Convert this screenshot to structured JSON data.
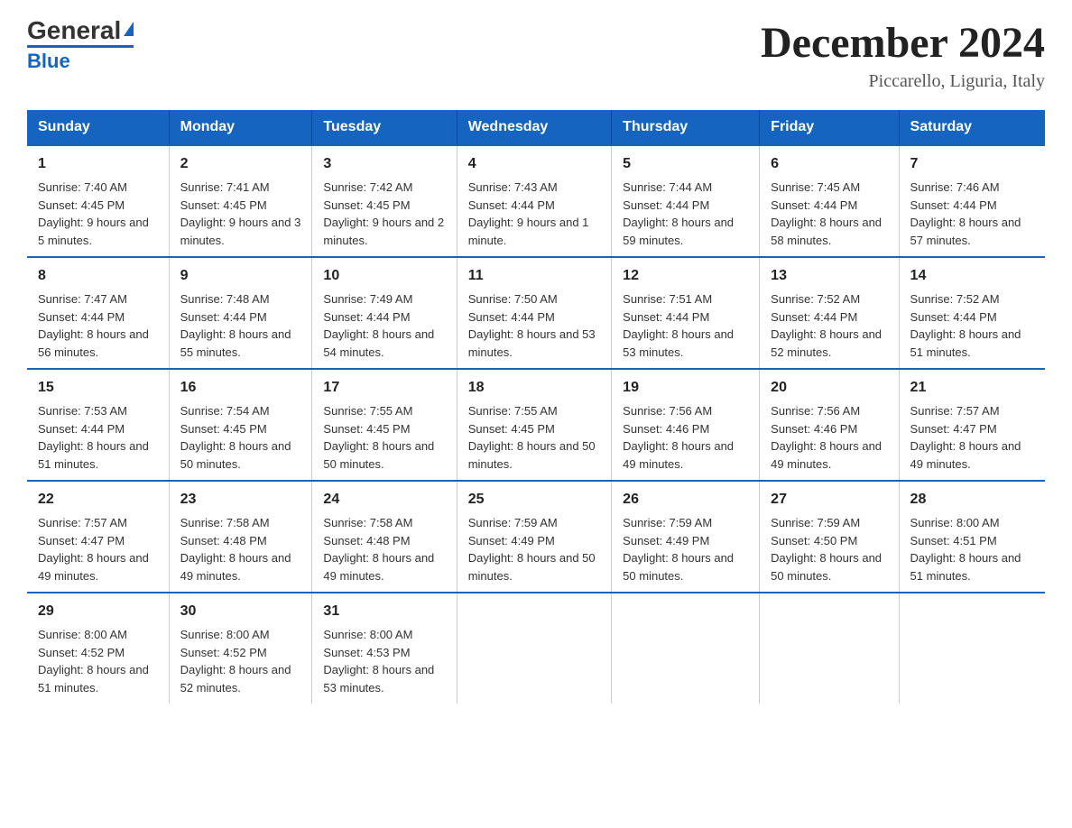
{
  "header": {
    "logo_general": "General",
    "logo_blue": "Blue",
    "month_title": "December 2024",
    "location": "Piccarello, Liguria, Italy"
  },
  "days_of_week": [
    "Sunday",
    "Monday",
    "Tuesday",
    "Wednesday",
    "Thursday",
    "Friday",
    "Saturday"
  ],
  "weeks": [
    [
      {
        "day": "1",
        "sunrise": "7:40 AM",
        "sunset": "4:45 PM",
        "daylight": "9 hours and 5 minutes."
      },
      {
        "day": "2",
        "sunrise": "7:41 AM",
        "sunset": "4:45 PM",
        "daylight": "9 hours and 3 minutes."
      },
      {
        "day": "3",
        "sunrise": "7:42 AM",
        "sunset": "4:45 PM",
        "daylight": "9 hours and 2 minutes."
      },
      {
        "day": "4",
        "sunrise": "7:43 AM",
        "sunset": "4:44 PM",
        "daylight": "9 hours and 1 minute."
      },
      {
        "day": "5",
        "sunrise": "7:44 AM",
        "sunset": "4:44 PM",
        "daylight": "8 hours and 59 minutes."
      },
      {
        "day": "6",
        "sunrise": "7:45 AM",
        "sunset": "4:44 PM",
        "daylight": "8 hours and 58 minutes."
      },
      {
        "day": "7",
        "sunrise": "7:46 AM",
        "sunset": "4:44 PM",
        "daylight": "8 hours and 57 minutes."
      }
    ],
    [
      {
        "day": "8",
        "sunrise": "7:47 AM",
        "sunset": "4:44 PM",
        "daylight": "8 hours and 56 minutes."
      },
      {
        "day": "9",
        "sunrise": "7:48 AM",
        "sunset": "4:44 PM",
        "daylight": "8 hours and 55 minutes."
      },
      {
        "day": "10",
        "sunrise": "7:49 AM",
        "sunset": "4:44 PM",
        "daylight": "8 hours and 54 minutes."
      },
      {
        "day": "11",
        "sunrise": "7:50 AM",
        "sunset": "4:44 PM",
        "daylight": "8 hours and 53 minutes."
      },
      {
        "day": "12",
        "sunrise": "7:51 AM",
        "sunset": "4:44 PM",
        "daylight": "8 hours and 53 minutes."
      },
      {
        "day": "13",
        "sunrise": "7:52 AM",
        "sunset": "4:44 PM",
        "daylight": "8 hours and 52 minutes."
      },
      {
        "day": "14",
        "sunrise": "7:52 AM",
        "sunset": "4:44 PM",
        "daylight": "8 hours and 51 minutes."
      }
    ],
    [
      {
        "day": "15",
        "sunrise": "7:53 AM",
        "sunset": "4:44 PM",
        "daylight": "8 hours and 51 minutes."
      },
      {
        "day": "16",
        "sunrise": "7:54 AM",
        "sunset": "4:45 PM",
        "daylight": "8 hours and 50 minutes."
      },
      {
        "day": "17",
        "sunrise": "7:55 AM",
        "sunset": "4:45 PM",
        "daylight": "8 hours and 50 minutes."
      },
      {
        "day": "18",
        "sunrise": "7:55 AM",
        "sunset": "4:45 PM",
        "daylight": "8 hours and 50 minutes."
      },
      {
        "day": "19",
        "sunrise": "7:56 AM",
        "sunset": "4:46 PM",
        "daylight": "8 hours and 49 minutes."
      },
      {
        "day": "20",
        "sunrise": "7:56 AM",
        "sunset": "4:46 PM",
        "daylight": "8 hours and 49 minutes."
      },
      {
        "day": "21",
        "sunrise": "7:57 AM",
        "sunset": "4:47 PM",
        "daylight": "8 hours and 49 minutes."
      }
    ],
    [
      {
        "day": "22",
        "sunrise": "7:57 AM",
        "sunset": "4:47 PM",
        "daylight": "8 hours and 49 minutes."
      },
      {
        "day": "23",
        "sunrise": "7:58 AM",
        "sunset": "4:48 PM",
        "daylight": "8 hours and 49 minutes."
      },
      {
        "day": "24",
        "sunrise": "7:58 AM",
        "sunset": "4:48 PM",
        "daylight": "8 hours and 49 minutes."
      },
      {
        "day": "25",
        "sunrise": "7:59 AM",
        "sunset": "4:49 PM",
        "daylight": "8 hours and 50 minutes."
      },
      {
        "day": "26",
        "sunrise": "7:59 AM",
        "sunset": "4:49 PM",
        "daylight": "8 hours and 50 minutes."
      },
      {
        "day": "27",
        "sunrise": "7:59 AM",
        "sunset": "4:50 PM",
        "daylight": "8 hours and 50 minutes."
      },
      {
        "day": "28",
        "sunrise": "8:00 AM",
        "sunset": "4:51 PM",
        "daylight": "8 hours and 51 minutes."
      }
    ],
    [
      {
        "day": "29",
        "sunrise": "8:00 AM",
        "sunset": "4:52 PM",
        "daylight": "8 hours and 51 minutes."
      },
      {
        "day": "30",
        "sunrise": "8:00 AM",
        "sunset": "4:52 PM",
        "daylight": "8 hours and 52 minutes."
      },
      {
        "day": "31",
        "sunrise": "8:00 AM",
        "sunset": "4:53 PM",
        "daylight": "8 hours and 53 minutes."
      },
      null,
      null,
      null,
      null
    ]
  ]
}
